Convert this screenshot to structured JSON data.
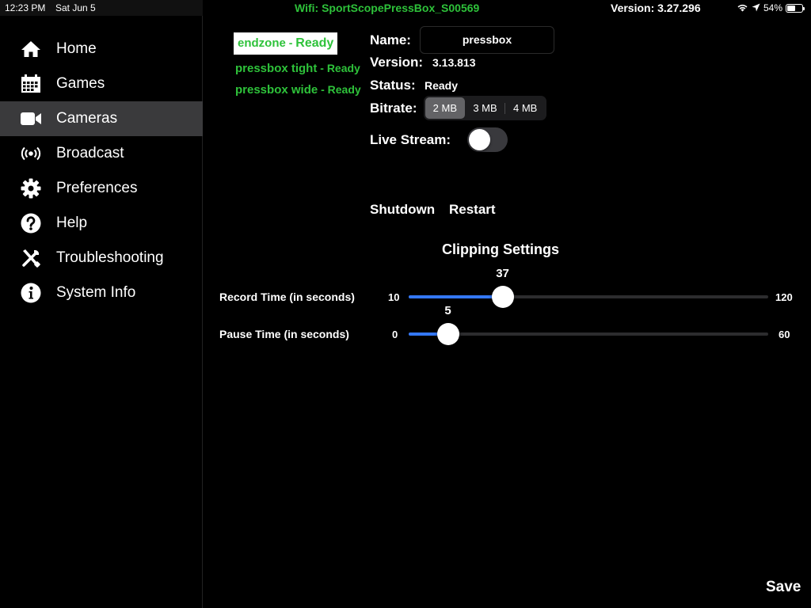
{
  "status_bar": {
    "time": "12:23 PM",
    "date": "Sat Jun 5",
    "wifi": "Wifi: SportScopePressBox_S00569",
    "version": "Version: 3.27.296",
    "battery_percent": "54%",
    "battery_level": 0.54
  },
  "sidebar": {
    "items": [
      {
        "label": "Home",
        "icon": "home-icon"
      },
      {
        "label": "Games",
        "icon": "calendar-icon"
      },
      {
        "label": "Cameras",
        "icon": "video-camera-icon",
        "active": true
      },
      {
        "label": "Broadcast",
        "icon": "broadcast-icon"
      },
      {
        "label": "Preferences",
        "icon": "gear-icon"
      },
      {
        "label": "Help",
        "icon": "question-icon"
      },
      {
        "label": "Troubleshooting",
        "icon": "tools-icon"
      },
      {
        "label": "System Info",
        "icon": "info-icon"
      }
    ]
  },
  "cameras": [
    {
      "name": "endzone",
      "status": "Ready",
      "separator": " - ",
      "selected": true
    },
    {
      "name": "pressbox tight",
      "status": "Ready",
      "separator": " - "
    },
    {
      "name": "pressbox wide",
      "status": "Ready",
      "separator": " - "
    }
  ],
  "details": {
    "name_label": "Name:",
    "name_value": "pressbox",
    "version_label": "Version:",
    "version_value": "3.13.813",
    "status_label": "Status:",
    "status_value": "Ready",
    "bitrate_label": "Bitrate:",
    "bitrate_options": [
      "2 MB",
      "3 MB",
      "4 MB"
    ],
    "bitrate_selected": "2 MB",
    "live_stream_label": "Live Stream:",
    "live_stream_on": false
  },
  "actions": {
    "shutdown": "Shutdown",
    "restart": "Restart",
    "save": "Save"
  },
  "clipping": {
    "title": "Clipping Settings",
    "record": {
      "label": "Record Time (in seconds)",
      "min": 10,
      "max": 120,
      "value": 37,
      "min_text": "10",
      "max_text": "120",
      "value_text": "37"
    },
    "pause": {
      "label": "Pause Time (in seconds)",
      "min": 0,
      "max": 60,
      "value": 5,
      "min_text": "0",
      "max_text": "60",
      "value_text": "5"
    }
  },
  "colors": {
    "accent_green": "#2ec23a",
    "slider_blue": "#3478f6",
    "active_nav": "#3a3a3c"
  }
}
